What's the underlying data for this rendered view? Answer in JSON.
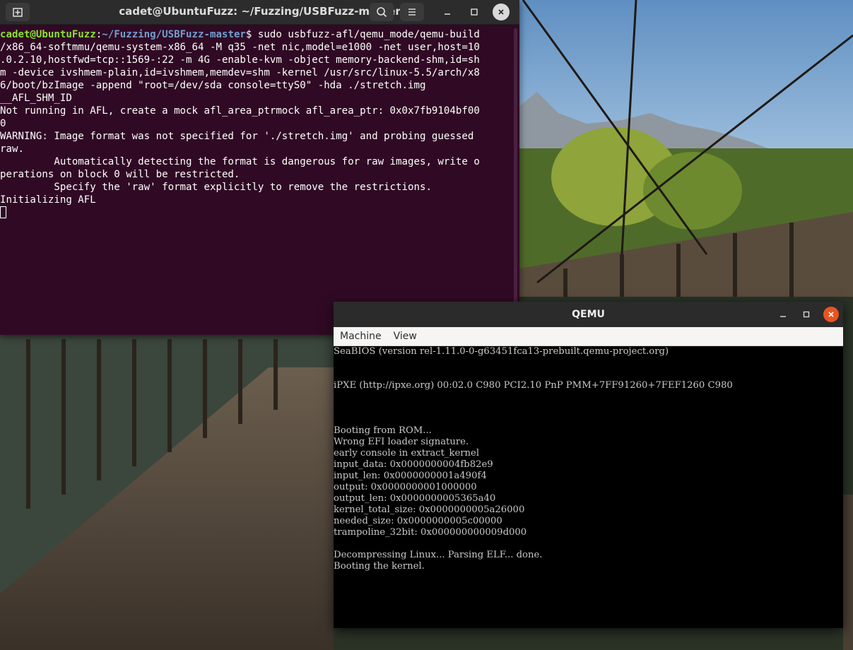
{
  "terminal": {
    "title": "cadet@UbuntuFuzz: ~/Fuzzing/USBFuzz-master",
    "prompt_user": "cadet@UbuntuFuzz",
    "prompt_sep": ":",
    "prompt_path": "~/Fuzzing/USBFuzz-master",
    "prompt_symbol": "$ ",
    "command_first": "sudo usbfuzz-afl/qemu_mode/qemu-build",
    "lines": [
      "/x86_64-softmmu/qemu-system-x86_64 -M q35 -net nic,model=e1000 -net user,host=10",
      ".0.2.10,hostfwd=tcp::1569-:22 -m 4G -enable-kvm -object memory-backend-shm,id=sh",
      "m -device ivshmem-plain,id=ivshmem,memdev=shm -kernel /usr/src/linux-5.5/arch/x8",
      "6/boot/bzImage -append \"root=/dev/sda console=ttyS0\" -hda ./stretch.img",
      "__AFL_SHM_ID",
      "Not running in AFL, create a mock afl_area_ptrmock afl_area_ptr: 0x0x7fb9104bf00",
      "0",
      "WARNING: Image format was not specified for './stretch.img' and probing guessed",
      "raw.",
      "         Automatically detecting the format is dangerous for raw images, write o",
      "perations on block 0 will be restricted.",
      "         Specify the 'raw' format explicitly to remove the restrictions.",
      "Initializing AFL"
    ]
  },
  "qemu": {
    "title": "QEMU",
    "menu": [
      "Machine",
      "View"
    ],
    "screen_lines": [
      "SeaBIOS (version rel-1.11.0-0-g63451fca13-prebuilt.qemu-project.org)",
      "",
      "",
      "iPXE (http://ipxe.org) 00:02.0 C980 PCI2.10 PnP PMM+7FF91260+7FEF1260 C980",
      "",
      "",
      "",
      "Booting from ROM...",
      "Wrong EFI loader signature.",
      "early console in extract_kernel",
      "input_data: 0x0000000004fb82e9",
      "input_len: 0x0000000001a490f4",
      "output: 0x0000000001000000",
      "output_len: 0x0000000005365a40",
      "kernel_total_size: 0x0000000005a26000",
      "needed_size: 0x0000000005c00000",
      "trampoline_32bit: 0x000000000009d000",
      "",
      "Decompressing Linux... Parsing ELF... done.",
      "Booting the kernel."
    ]
  },
  "icons": {
    "new_tab": "new-tab-icon",
    "search": "search-icon",
    "menu": "hamburger-menu-icon",
    "minimize": "minimize-icon",
    "maximize": "maximize-icon",
    "close": "close-icon"
  },
  "colors": {
    "terminal_bg": "#300a24",
    "prompt_user": "#8ae234",
    "prompt_path": "#729fcf",
    "qemu_close": "#e95420"
  }
}
